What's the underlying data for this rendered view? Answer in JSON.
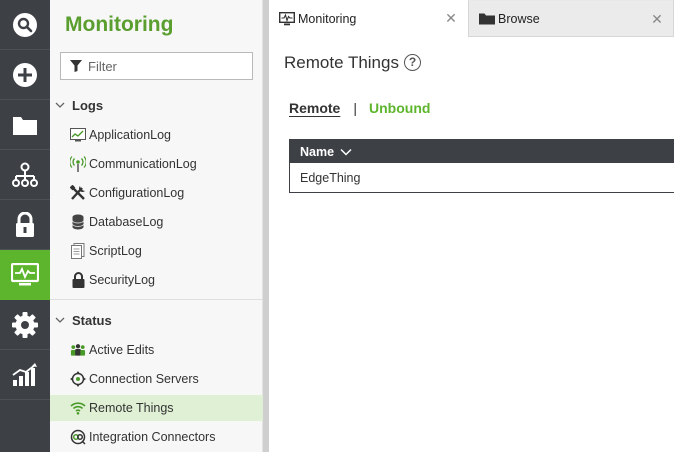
{
  "nav": {
    "title": "Monitoring",
    "filter_placeholder": "Filter",
    "sections": [
      {
        "label": "Logs",
        "items": [
          {
            "label": "ApplicationLog",
            "icon": "application-log-icon"
          },
          {
            "label": "CommunicationLog",
            "icon": "communication-log-icon"
          },
          {
            "label": "ConfigurationLog",
            "icon": "configuration-log-icon"
          },
          {
            "label": "DatabaseLog",
            "icon": "database-log-icon"
          },
          {
            "label": "ScriptLog",
            "icon": "script-log-icon"
          },
          {
            "label": "SecurityLog",
            "icon": "security-log-icon"
          }
        ]
      },
      {
        "label": "Status",
        "items": [
          {
            "label": "Active Edits",
            "icon": "active-edits-icon"
          },
          {
            "label": "Connection Servers",
            "icon": "connection-servers-icon"
          },
          {
            "label": "Remote Things",
            "icon": "remote-things-icon",
            "selected": true
          },
          {
            "label": "Integration Connectors",
            "icon": "integration-connectors-icon"
          }
        ]
      }
    ]
  },
  "rail": {
    "items": [
      "search-icon",
      "add-icon",
      "folder-icon",
      "hierarchy-icon",
      "lock-icon",
      "monitoring-icon",
      "gear-icon",
      "analytics-icon"
    ],
    "active": "monitoring-icon"
  },
  "tabs": [
    {
      "label": "Monitoring",
      "active": true
    },
    {
      "label": "Browse",
      "active": false
    }
  ],
  "main": {
    "title": "Remote Things",
    "help_glyph": "?",
    "subtabs": {
      "remote": "Remote",
      "separator": "|",
      "unbound": "Unbound"
    },
    "grid": {
      "column": "Name",
      "rows": [
        "EdgeThing"
      ]
    }
  },
  "colors": {
    "accent": "#5db52d",
    "rail": "#3d4146",
    "selected_row": "#dff0d4",
    "title_green": "#5a9e2f"
  }
}
